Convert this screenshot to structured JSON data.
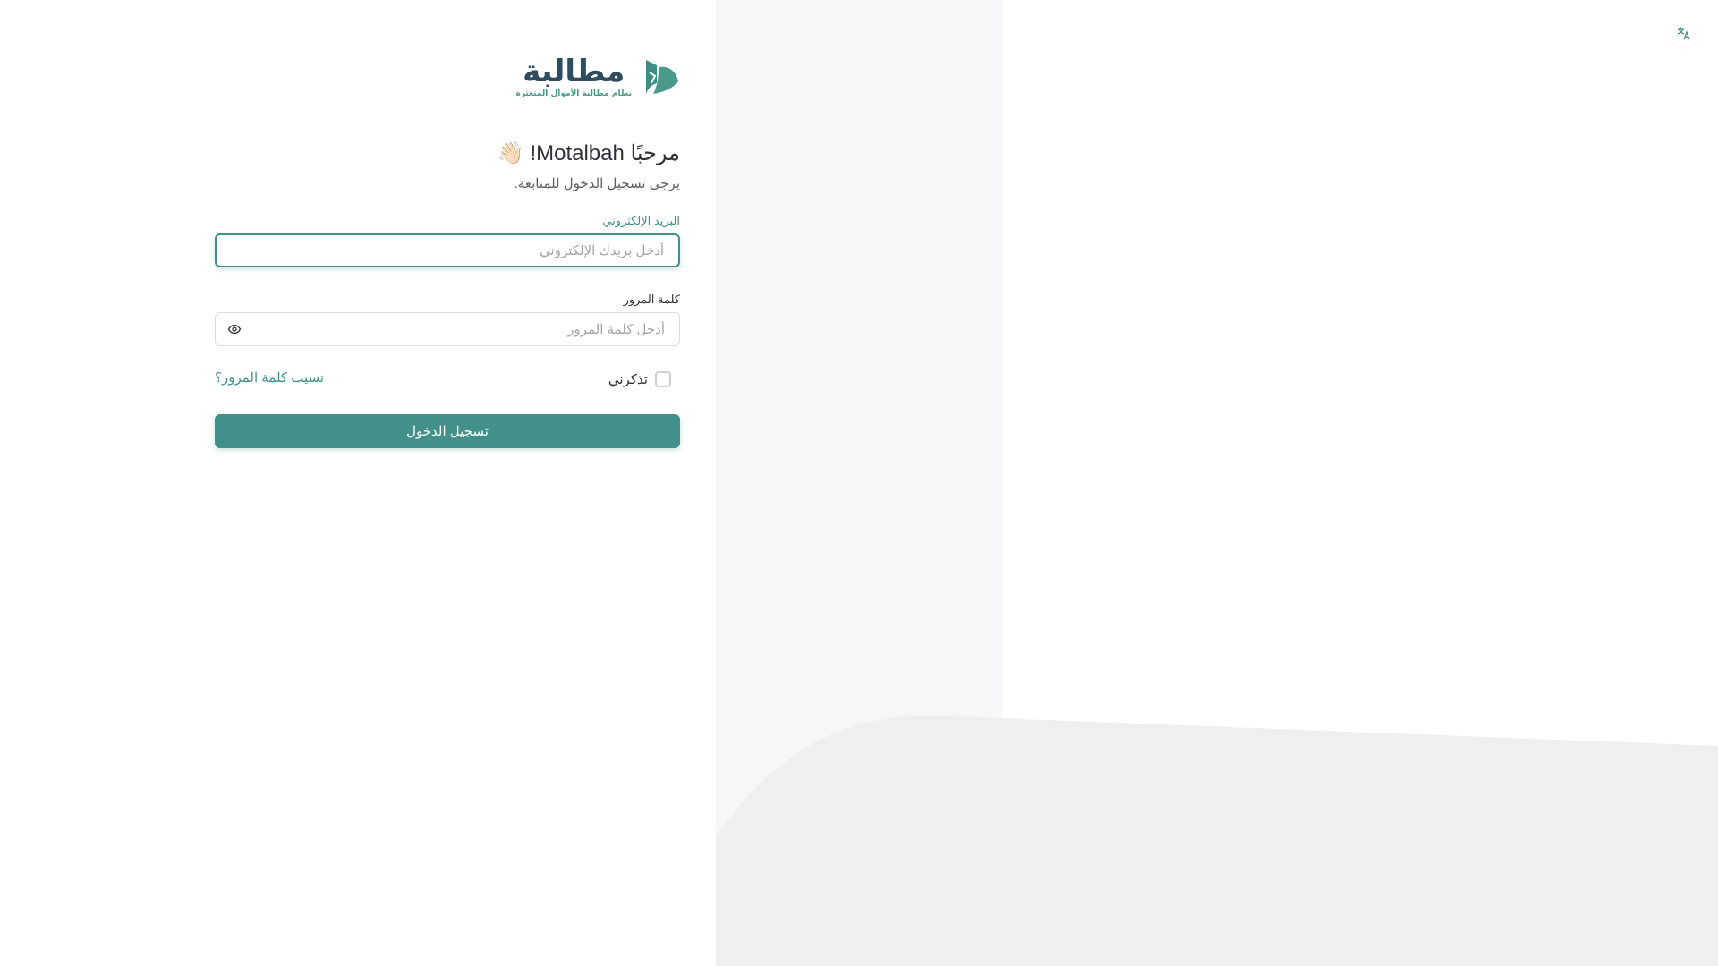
{
  "brand": {
    "name": "مطالبة",
    "tagline": "نظام مطالبة الأموال المتعثرة",
    "primary_color": "#42908a",
    "dark_color": "#2f4d5e"
  },
  "header": {
    "language_toggle_icon": "translate-icon",
    "language_toggle_glyph": "文A"
  },
  "login": {
    "title": "مرحبًا Motalbah! 👋🏻",
    "subtitle": "يرجى تسجيل الدخول للمتابعة.",
    "email": {
      "label": "البريد الإلكتروني",
      "placeholder": "أدخل بريدك الإلكتروني",
      "value": ""
    },
    "password": {
      "label": "كلمة المرور",
      "placeholder": "أدخل كلمة المرور",
      "value": "",
      "toggle_icon": "eye-icon"
    },
    "remember_me": {
      "label": "تذكرني",
      "checked": false
    },
    "forgot_password": "نسيت كلمة المرور؟",
    "submit_label": "تسجيل الدخول"
  }
}
